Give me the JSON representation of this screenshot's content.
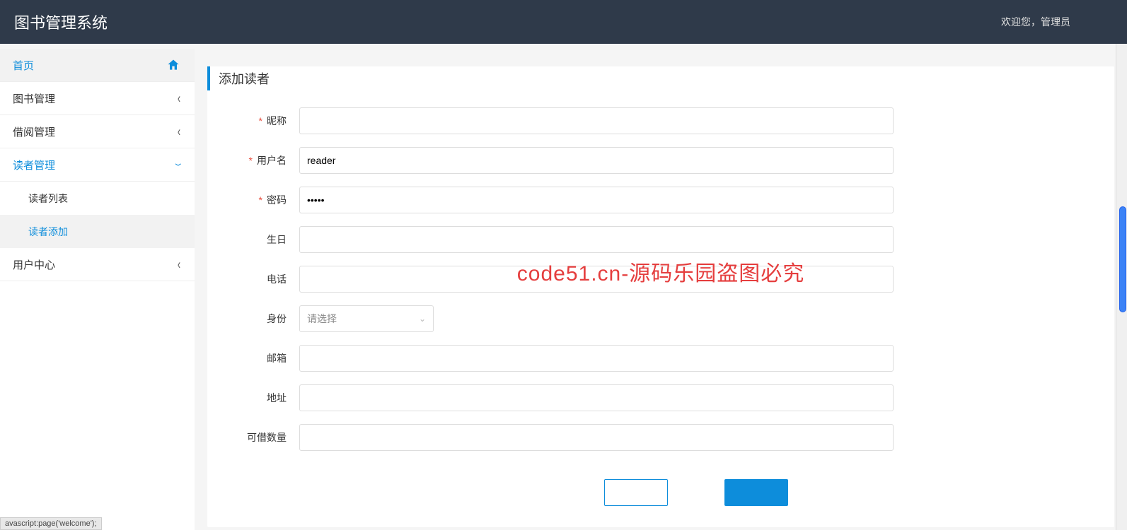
{
  "topbar": {
    "title": "图书管理系统",
    "welcome": "欢迎您，管理员"
  },
  "sidebar": {
    "home": "首页",
    "book_mgmt": "图书管理",
    "borrow_mgmt": "借阅管理",
    "reader_mgmt": "读者管理",
    "reader_list": "读者列表",
    "reader_add": "读者添加",
    "user_center": "用户中心"
  },
  "page": {
    "title": "添加读者"
  },
  "form": {
    "nickname": {
      "label": "昵称",
      "value": ""
    },
    "username": {
      "label": "用户名",
      "value": "reader"
    },
    "password": {
      "label": "密码",
      "value": "•••••"
    },
    "birthday": {
      "label": "生日",
      "value": ""
    },
    "phone": {
      "label": "电话",
      "value": ""
    },
    "identity": {
      "label": "身份",
      "placeholder": "请选择"
    },
    "email": {
      "label": "邮箱",
      "value": ""
    },
    "address": {
      "label": "地址",
      "value": ""
    },
    "borrow_qty": {
      "label": "可借数量",
      "value": ""
    }
  },
  "watermark": "code51.cn-源码乐园盗图必究",
  "statusbar": "avascript:page('welcome');"
}
